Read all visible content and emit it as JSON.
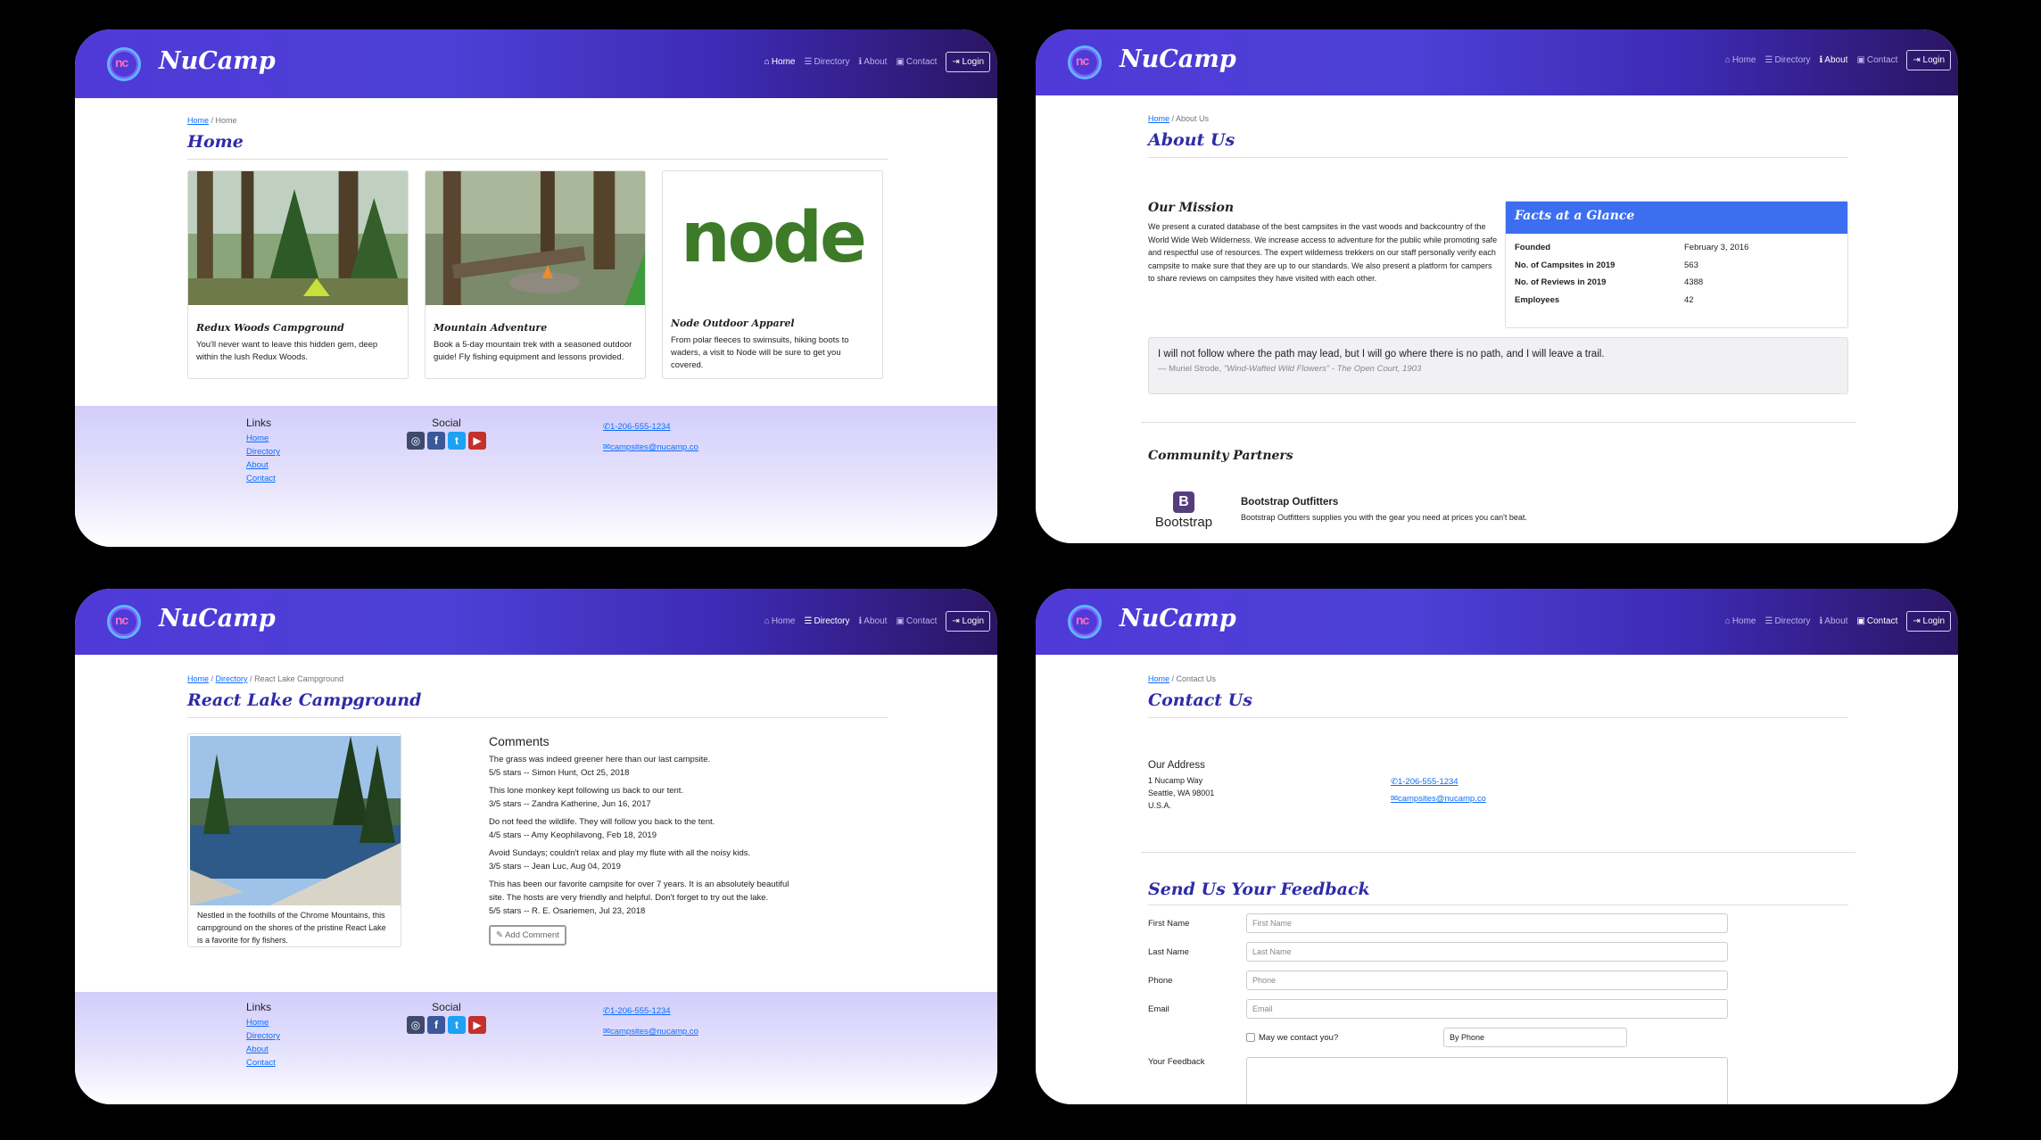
{
  "nav": {
    "brand": "NuCamp",
    "items": [
      {
        "icon": "home-icon",
        "label": "Home"
      },
      {
        "icon": "list-icon",
        "label": "Directory"
      },
      {
        "icon": "info-icon",
        "label": "About"
      },
      {
        "icon": "address-card-icon",
        "label": "Contact"
      }
    ],
    "login": "Login"
  },
  "footer": {
    "links_title": "Links",
    "links": [
      "Home",
      "Directory",
      "About",
      "Contact"
    ],
    "social_title": "Social",
    "phone": "1-206-555-1234",
    "email": "campsites@nucamp.co"
  },
  "home": {
    "breadcrumb": [
      "Home",
      "Home"
    ],
    "title": "Home",
    "cards": [
      {
        "title": "Redux Woods Campground",
        "text": "You'll never want to leave this hidden gem, deep within the lush Redux Woods."
      },
      {
        "title": "Mountain Adventure",
        "text": "Book a 5-day mountain trek with a seasoned outdoor guide! Fly fishing equipment and lessons provided."
      },
      {
        "title": "Node Outdoor Apparel",
        "text": "From polar fleeces to swimsuits, hiking boots to waders, a visit to Node will be sure to get you covered.",
        "logo_text": "node"
      }
    ]
  },
  "about": {
    "breadcrumb": [
      "Home",
      "About Us"
    ],
    "title": "About Us",
    "mission_title": "Our Mission",
    "mission_text": "We present a curated database of the best campsites in the vast woods and backcountry of the World Wide Web Wilderness. We increase access to adventure for the public while promoting safe and respectful use of resources. The expert wilderness trekkers on our staff personally verify each campsite to make sure that they are up to our standards. We also present a platform for campers to share reviews on campsites they have visited with each other.",
    "facts_title": "Facts at a Glance",
    "facts": [
      {
        "k": "Founded",
        "v": "February 3, 2016"
      },
      {
        "k": "No. of Campsites in 2019",
        "v": "563"
      },
      {
        "k": "No. of Reviews in 2019",
        "v": "4388"
      },
      {
        "k": "Employees",
        "v": "42"
      }
    ],
    "quote": "I will not follow where the path may lead, but I will go where there is no path, and I will leave a trail.",
    "quote_author": "— Muriel Strode, ",
    "quote_book": "\"Wind-Wafted Wild Flowers\"",
    "quote_pub": " - The Open Court, 1903",
    "partners_title": "Community Partners",
    "partner_name": "Bootstrap Outfitters",
    "partner_text": "Bootstrap Outfitters supplies you with the gear you need at prices you can't beat.",
    "partner_logo_letter": "B",
    "partner_logo_text": "Bootstrap"
  },
  "campsite": {
    "breadcrumb": [
      "Home",
      "Directory",
      "React Lake Campground"
    ],
    "title": "React Lake Campground",
    "caption": "Nestled in the foothills of the Chrome Mountains, this campground on the shores of the pristine React Lake is a favorite for fly fishers.",
    "comments_title": "Comments",
    "comments": [
      {
        "text": "The grass was indeed greener here than our last campsite.",
        "meta": "5/5 stars -- Simon Hunt, Oct 25, 2018"
      },
      {
        "text": "This lone monkey kept following us back to our tent.",
        "meta": "3/5 stars -- Zandra Katherine, Jun 16, 2017"
      },
      {
        "text": "Do not feed the wildlife. They will follow you back to the tent.",
        "meta": "4/5 stars -- Amy Keophilavong, Feb 18, 2019"
      },
      {
        "text": "Avoid Sundays; couldn't relax and play my flute with all the noisy kids.",
        "meta": "3/5 stars -- Jean Luc, Aug 04, 2019"
      },
      {
        "text": "This has been our favorite campsite for over 7 years. It is an absolutely beautiful site. The hosts are very friendly and helpful. Don't forget to try out the lake.",
        "meta": "5/5 stars -- R. E. Osariemen, Jul 23, 2018"
      }
    ],
    "add_comment": "Add Comment"
  },
  "contact": {
    "breadcrumb": [
      "Home",
      "Contact Us"
    ],
    "title": "Contact Us",
    "address_title": "Our Address",
    "address": [
      "1 Nucamp Way",
      "Seattle, WA 98001",
      "U.S.A."
    ],
    "feedback_title": "Send Us Your Feedback",
    "fields": [
      {
        "label": "First Name",
        "placeholder": "First Name"
      },
      {
        "label": "Last Name",
        "placeholder": "Last Name"
      },
      {
        "label": "Phone",
        "placeholder": "Phone"
      },
      {
        "label": "Email",
        "placeholder": "Email"
      }
    ],
    "may_contact": "May we contact you?",
    "contact_method": "By Phone",
    "feedback_label": "Your Feedback"
  }
}
